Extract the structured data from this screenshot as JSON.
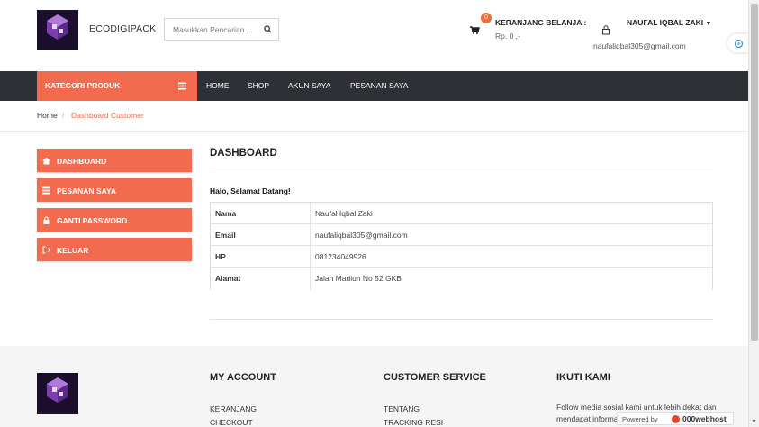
{
  "brand": {
    "name": "ECODIGIPACK",
    "logo_text": "ECODIGIPACK"
  },
  "search": {
    "placeholder": "Masukkan Pencarian ..."
  },
  "cart": {
    "count": "0",
    "title": "KERANJANG BELANJA :",
    "total": "Rp. 0 ,-"
  },
  "user": {
    "name": "NAUFAL IQBAL ZAKI",
    "email": "naufaliqbal305@gmail.com"
  },
  "navbar": {
    "category_label": "KATEGORI PRODUK",
    "items": [
      {
        "label": "HOME"
      },
      {
        "label": "SHOP"
      },
      {
        "label": "AKUN SAYA"
      },
      {
        "label": "PESANAN SAYA"
      }
    ]
  },
  "breadcrumb": {
    "home": "Home",
    "separator": "/",
    "current": "Dashboard Customer"
  },
  "sidebar": {
    "items": [
      {
        "label": "DASHBOARD",
        "icon": "home-icon"
      },
      {
        "label": "PESANAN SAYA",
        "icon": "list-icon"
      },
      {
        "label": "GANTI PASSWORD",
        "icon": "lock-icon"
      },
      {
        "label": "KELUAR",
        "icon": "sign-out-icon"
      }
    ]
  },
  "main": {
    "title": "DASHBOARD",
    "greeting": "Halo, Selamat Datang!",
    "rows": [
      {
        "key": "Nama",
        "value": "Naufal Iqbal Zaki"
      },
      {
        "key": "Email",
        "value": "naufaliqbal305@gmail.com"
      },
      {
        "key": "HP",
        "value": "081234049926"
      },
      {
        "key": "Alamat",
        "value": "Jalan Madiun No 52 GKB"
      }
    ]
  },
  "footer": {
    "my_account": {
      "title": "MY ACCOUNT",
      "links": [
        "KERANJANG",
        "CHECKOUT"
      ]
    },
    "customer_service": {
      "title": "CUSTOMER SERVICE",
      "links": [
        "TENTANG",
        "TRACKING RESI"
      ]
    },
    "follow": {
      "title": "IKUTI KAMI",
      "text": "Follow media sosial kami untuk lebih dekat dan mendapat informasi terbaru"
    }
  },
  "powered_by": {
    "prefix": "Powered by",
    "host": "000webhost"
  },
  "colors": {
    "accent": "#f26b4e",
    "nav_bg": "#2f3035",
    "logo_bg": "#1b0f2c"
  }
}
